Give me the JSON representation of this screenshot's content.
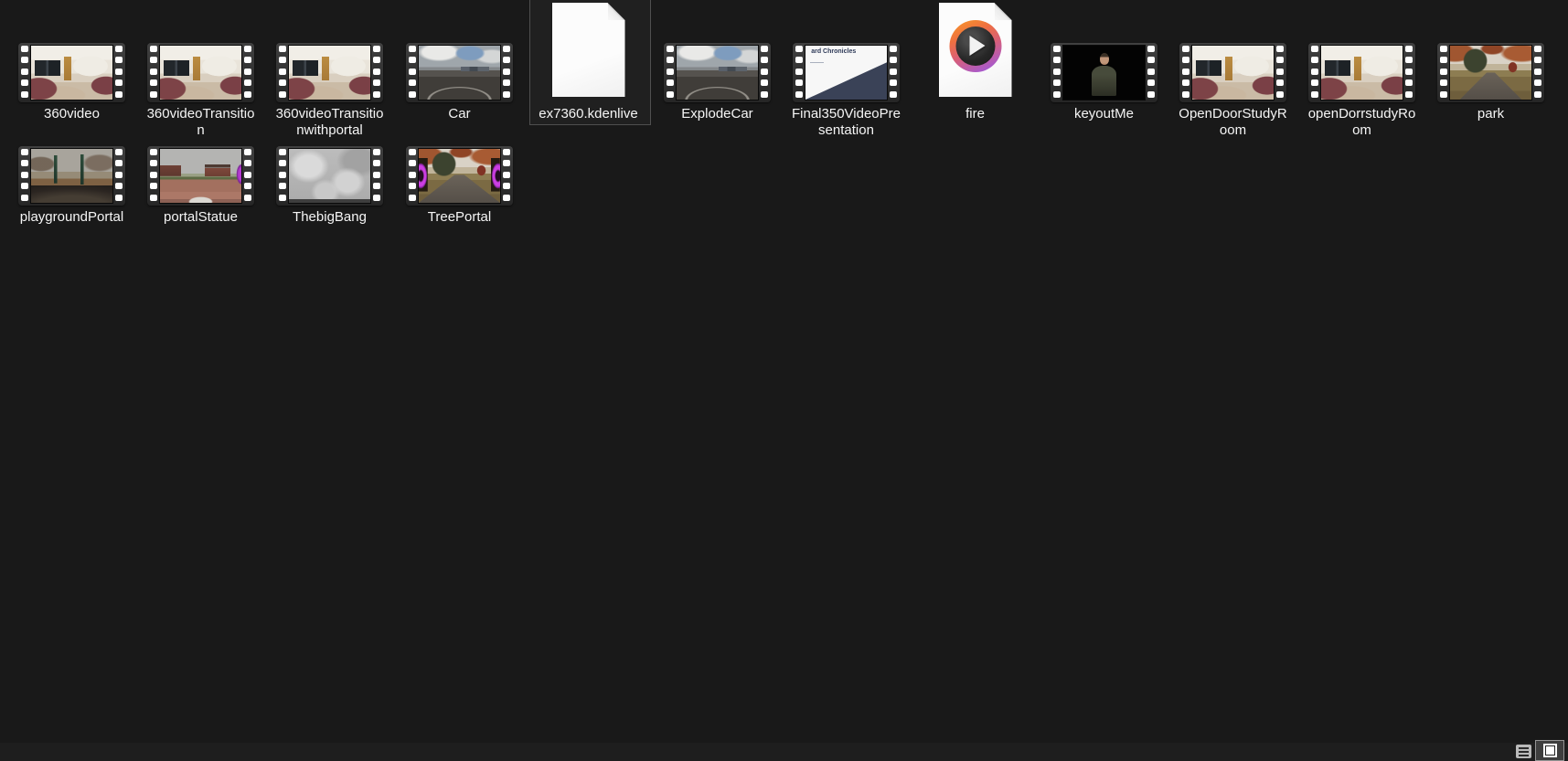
{
  "view": {
    "mode": "large-thumbnails",
    "background_color": "#191919",
    "label_text_color": "#f5f5f5",
    "selection": {
      "selected_file": "ex7360.kdenlive",
      "border_color": "#4f4f4f"
    }
  },
  "files": [
    {
      "label": "360video",
      "kind": "video",
      "selected": false
    },
    {
      "label": "360videoTransition",
      "kind": "video",
      "selected": false
    },
    {
      "label": "360videoTransitionwithportal",
      "kind": "video",
      "selected": false
    },
    {
      "label": "Car",
      "kind": "video",
      "selected": false
    },
    {
      "label": "ex7360.kdenlive",
      "kind": "kdenlive-project-document",
      "selected": true
    },
    {
      "label": "ExplodeCar",
      "kind": "video",
      "selected": false
    },
    {
      "label": "Final350VideoPresentation",
      "kind": "video",
      "selected": false
    },
    {
      "label": "fire",
      "kind": "media-player-document",
      "selected": false
    },
    {
      "label": "keyoutMe",
      "kind": "video",
      "selected": false
    },
    {
      "label": "OpenDoorStudyRoom",
      "kind": "video",
      "selected": false
    },
    {
      "label": "openDorrstudyRoom",
      "kind": "video",
      "selected": false
    },
    {
      "label": "park",
      "kind": "video",
      "selected": false
    },
    {
      "label": "playgroundPortal",
      "kind": "video",
      "selected": false
    },
    {
      "label": "portalStatue",
      "kind": "video",
      "selected": false
    },
    {
      "label": "ThebigBang",
      "kind": "video",
      "selected": false
    },
    {
      "label": "TreePortal",
      "kind": "video",
      "selected": false
    }
  ],
  "thumbnails": {
    "slide_text": "ard Chronicles"
  },
  "statusbar": {
    "background_color": "#1e1e1e",
    "buttons": [
      {
        "name": "details-view",
        "icon": "list-lines-icon",
        "active": false
      },
      {
        "name": "large-thumbnails-view",
        "icon": "large-square-icon",
        "active": true
      }
    ]
  },
  "colors": {
    "filmstrip_frame": "#333333",
    "sprocket_holes": "#ffffff",
    "portal_purple": "#b43bd0",
    "player_logo_gradient": [
      "#f5902d",
      "#a85ace"
    ]
  }
}
